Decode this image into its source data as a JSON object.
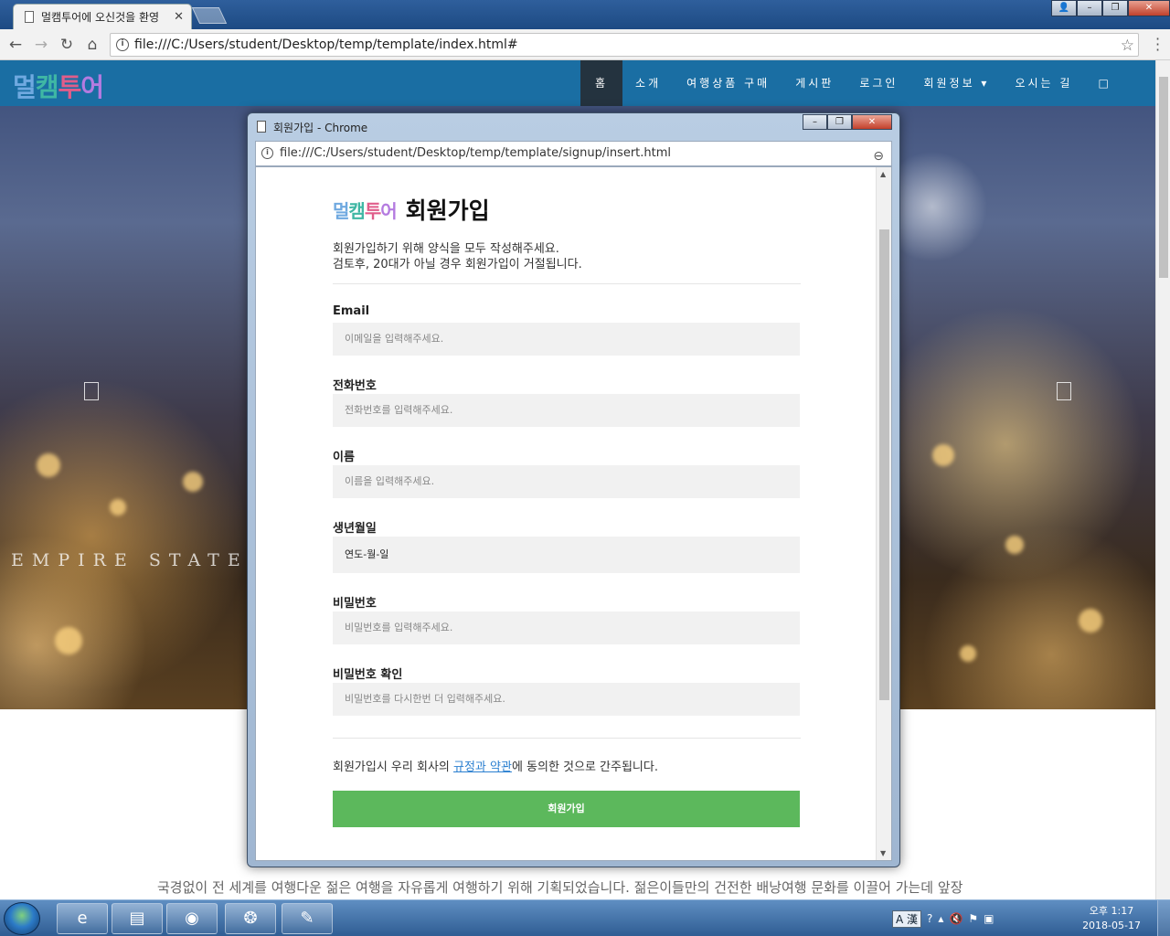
{
  "browser": {
    "tab_title": "멀캠투어에 오신것을 환영",
    "url": "file:///C:/Users/student/Desktop/temp/template/index.html#"
  },
  "site": {
    "logo_text": "멀캠투어",
    "nav": [
      "홈",
      "소개",
      "여행상품 구매",
      "게시판",
      "로그인",
      "회원정보 ▾",
      "오시는 길",
      "□"
    ],
    "hero_caption": "EMPIRE STATE C",
    "intro_text": "국경없이 전 세계를 여행다운 젊은 여행을 자유롭게 여행하기 위해 기획되었습니다. 젊은이들만의 건전한 배낭여행 문화를 이끌어 가는데 앞장"
  },
  "popup": {
    "window_title": "회원가입 - Chrome",
    "url": "file:///C:/Users/student/Desktop/temp/template/signup/insert.html",
    "logo_text": "멀캠투어",
    "title": "회원가입",
    "desc_line1": "회원가입하기 위해 양식을 모두 작성해주세요.",
    "desc_line2": "검토후, 20대가 아닐 경우 회원가입이 거절됩니다.",
    "fields": [
      {
        "label": "Email",
        "placeholder": "이메일을 입력해주세요."
      },
      {
        "label": "전화번호",
        "placeholder": "전화번호를 입력해주세요."
      },
      {
        "label": "이름",
        "placeholder": "이름을 입력해주세요."
      },
      {
        "label": "생년월일",
        "placeholder": "연도-월-일"
      },
      {
        "label": "비밀번호",
        "placeholder": "비밀번호를 입력해주세요."
      },
      {
        "label": "비밀번호 확인",
        "placeholder": "비밀번호를 다시한번 더 입력해주세요."
      }
    ],
    "agree_prefix": "회원가입시 우리 회사의 ",
    "agree_link": "규정과 약관",
    "agree_suffix": "에 동의한 것으로 간주됩니다.",
    "submit_label": "회원가입"
  },
  "taskbar": {
    "ime": "A 漢",
    "time": "오후 1:17",
    "date": "2018-05-17"
  },
  "colors": {
    "navbar": "#1a6ea3",
    "submit": "#5cb85c",
    "link": "#2a7fd0"
  }
}
